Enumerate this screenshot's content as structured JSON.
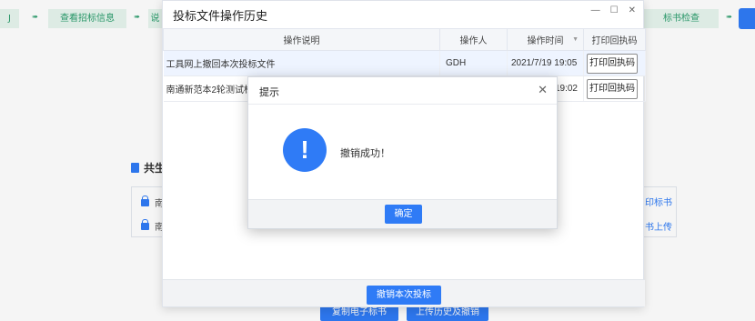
{
  "steps": [
    {
      "label": "Ϳ"
    },
    {
      "label": "查看招标信息"
    },
    {
      "label": "说"
    },
    {
      "label": "标书检查"
    }
  ],
  "shared": {
    "title": "共生",
    "rows": [
      "南",
      "南"
    ],
    "links": [
      "印标书",
      "书上传"
    ]
  },
  "bottom_buttons": [
    "复制电子标书",
    "上传历史及撤销"
  ],
  "history_dialog": {
    "title": "投标文件操作历史",
    "minimize": "—",
    "maximize": "☐",
    "close": "✕",
    "columns": [
      "操作说明",
      "操作人",
      "操作时间",
      "打印回执码"
    ],
    "rows": [
      {
        "desc": "工具网上撤回本次投标文件",
        "operator": "GDH",
        "time": "2021/7/19 19:05",
        "button": "打印回执码"
      },
      {
        "desc": "南通新范本2轮测试标",
        "operator": "",
        "time": "19:02",
        "button": "打印回执码"
      }
    ],
    "revoke_button": "撤销本次投标"
  },
  "prompt_dialog": {
    "title": "提示",
    "close": "✕",
    "icon_glyph": "!",
    "message": "撤销成功！",
    "ok_button": "确定"
  }
}
